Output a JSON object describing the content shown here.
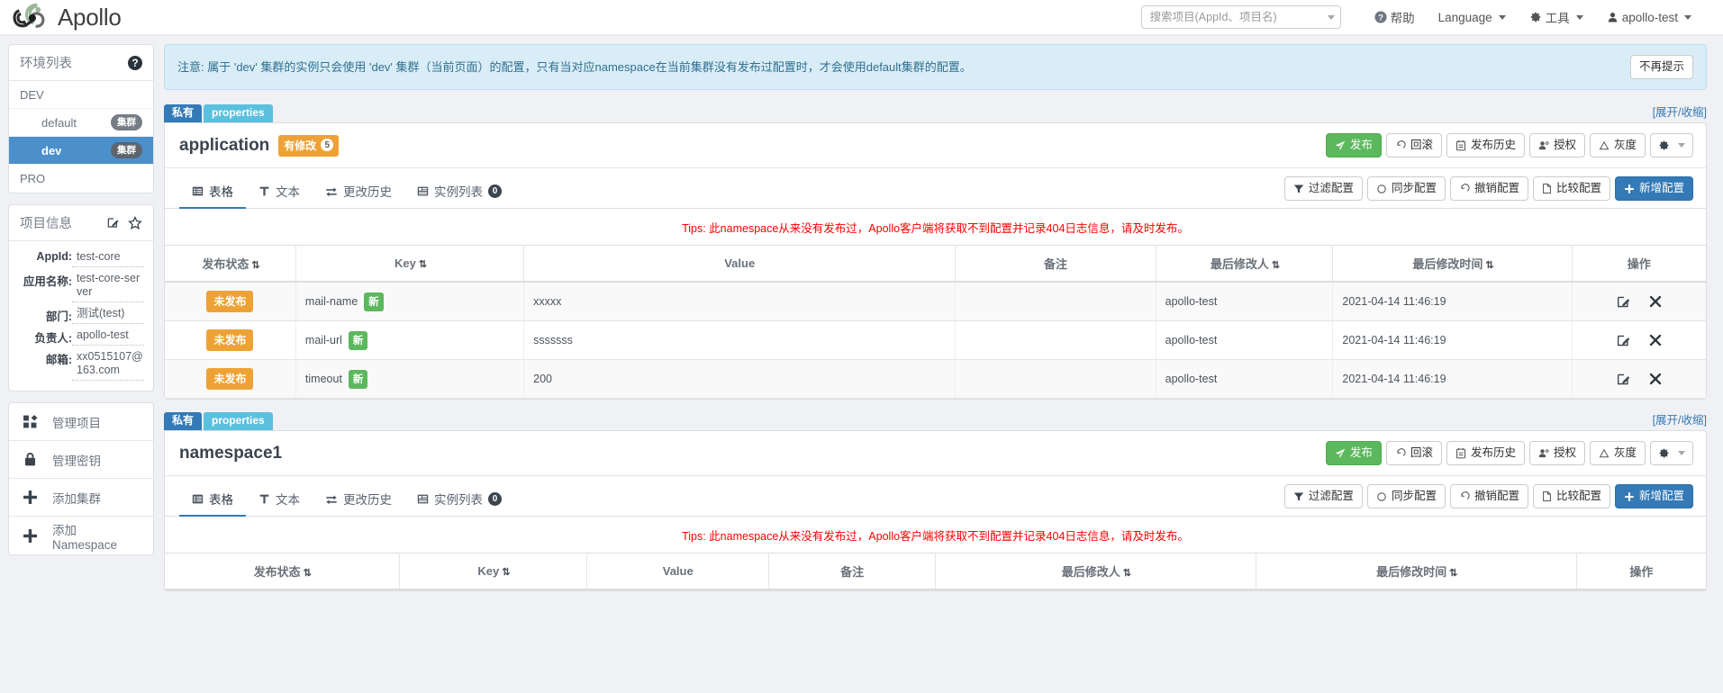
{
  "topnav": {
    "brand": "Apollo",
    "search_placeholder": "搜索项目(AppId、项目名)",
    "search_value": "",
    "help": "帮助",
    "language": "Language",
    "tools": "工具",
    "user": "apollo-test"
  },
  "sidebar": {
    "env_panel": {
      "title": "环境列表",
      "items": [
        {
          "label": "DEV",
          "tag": "",
          "level": "root",
          "active": false
        },
        {
          "label": "default",
          "tag": "集群",
          "level": "sub",
          "active": false
        },
        {
          "label": "dev",
          "tag": "集群",
          "level": "sub",
          "active": true
        },
        {
          "label": "PRO",
          "tag": "",
          "level": "root",
          "active": false
        }
      ]
    },
    "info_panel": {
      "title": "项目信息",
      "rows": [
        {
          "label": "AppId:",
          "value": "test-core"
        },
        {
          "label": "应用名称:",
          "value": "test-core-server"
        },
        {
          "label": "部门:",
          "value": "测试(test)"
        },
        {
          "label": "负责人:",
          "value": "apollo-test"
        },
        {
          "label": "邮箱:",
          "value": "xx0515107@163.com"
        }
      ]
    },
    "menu": [
      {
        "label": "管理项目",
        "icon": "grid-icon"
      },
      {
        "label": "管理密钥",
        "icon": "lock-icon"
      },
      {
        "label": "添加集群",
        "icon": "plus-icon"
      },
      {
        "label": "添加Namespace",
        "icon": "plus-icon"
      }
    ]
  },
  "alert": {
    "text": "注意: 属于 'dev' 集群的实例只会使用 'dev' 集群（当前页面）的配置，只有当对应namespace在当前集群没有发布过配置时，才会使用default集群的配置。",
    "dismiss_label": "不再提示"
  },
  "common": {
    "tag_private": "私有",
    "tag_format": "properties",
    "collapse_link": "[展开/收缩]",
    "tips_text": "Tips: 此namespace从来没有发布过，Apollo客户端将获取不到配置并记录404日志信息，请及时发布。",
    "header_actions": [
      {
        "label": "发布",
        "icon": "send-icon",
        "style": "green"
      },
      {
        "label": "回滚",
        "icon": "rollback-icon",
        "style": "default"
      },
      {
        "label": "发布历史",
        "icon": "history-icon",
        "style": "default"
      },
      {
        "label": "授权",
        "icon": "user-key-icon",
        "style": "default"
      },
      {
        "label": "灰度",
        "icon": "gray-release-icon",
        "style": "default"
      },
      {
        "label": "",
        "icon": "gear-icon",
        "style": "default"
      }
    ],
    "tabs": [
      {
        "label": "表格",
        "icon": "table-icon",
        "active": true,
        "count": null
      },
      {
        "label": "文本",
        "icon": "text-icon",
        "active": false,
        "count": null
      },
      {
        "label": "更改历史",
        "icon": "change-history-icon",
        "active": false,
        "count": null
      },
      {
        "label": "实例列表",
        "icon": "instance-icon",
        "active": false,
        "count": "0"
      }
    ],
    "tool_actions": [
      {
        "label": "过滤配置",
        "icon": "filter-icon",
        "style": "default"
      },
      {
        "label": "同步配置",
        "icon": "sync-icon",
        "style": "default"
      },
      {
        "label": "撤销配置",
        "icon": "revoke-icon",
        "style": "default"
      },
      {
        "label": "比较配置",
        "icon": "compare-icon",
        "style": "default"
      },
      {
        "label": "新增配置",
        "icon": "plus-icon",
        "style": "blue"
      }
    ],
    "columns": [
      {
        "label": "发布状态",
        "sortable": true
      },
      {
        "label": "Key",
        "sortable": true
      },
      {
        "label": "Value",
        "sortable": false
      },
      {
        "label": "备注",
        "sortable": false
      },
      {
        "label": "最后修改人",
        "sortable": true
      },
      {
        "label": "最后修改时间",
        "sortable": true
      },
      {
        "label": "操作",
        "sortable": false
      }
    ]
  },
  "namespaces": [
    {
      "name": "application",
      "modified_label": "有修改",
      "modified_count": "5",
      "rows": [
        {
          "state": "未发布",
          "key": "mail-name",
          "key_badge": "新",
          "value": "xxxxx",
          "comment": "",
          "modifier": "apollo-test",
          "modified_at": "2021-04-14 11:46:19"
        },
        {
          "state": "未发布",
          "key": "mail-url",
          "key_badge": "新",
          "value": "sssssss",
          "comment": "",
          "modifier": "apollo-test",
          "modified_at": "2021-04-14 11:46:19"
        },
        {
          "state": "未发布",
          "key": "timeout",
          "key_badge": "新",
          "value": "200",
          "comment": "",
          "modifier": "apollo-test",
          "modified_at": "2021-04-14 11:46:19"
        }
      ]
    },
    {
      "name": "namespace1",
      "modified_label": "",
      "modified_count": "",
      "rows": []
    }
  ]
}
